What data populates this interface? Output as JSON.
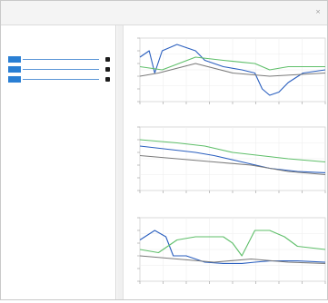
{
  "window": {
    "title": "",
    "close_glyph": "×"
  },
  "sidebar": {
    "section_label": "",
    "tracks": [
      {
        "label": "",
        "color": "#2a7fd4"
      },
      {
        "label": "",
        "color": "#2a7fd4"
      },
      {
        "label": "",
        "color": "#2a7fd4"
      }
    ]
  },
  "colors": {
    "blue": "#2a5fbf",
    "green": "#5fbf6a",
    "gray": "#7a7a7a",
    "accent": "#2a7fd4"
  },
  "charts": [
    {
      "name": "chart-1",
      "series": [
        {
          "color": "#2a5fbf",
          "points": [
            [
              0,
              0.3
            ],
            [
              0.05,
              0.2
            ],
            [
              0.08,
              0.55
            ],
            [
              0.12,
              0.2
            ],
            [
              0.2,
              0.1
            ],
            [
              0.3,
              0.2
            ],
            [
              0.35,
              0.35
            ],
            [
              0.45,
              0.45
            ],
            [
              0.55,
              0.5
            ],
            [
              0.62,
              0.55
            ],
            [
              0.66,
              0.8
            ],
            [
              0.7,
              0.9
            ],
            [
              0.75,
              0.85
            ],
            [
              0.8,
              0.7
            ],
            [
              0.88,
              0.55
            ],
            [
              1,
              0.5
            ]
          ]
        },
        {
          "color": "#5fbf6a",
          "points": [
            [
              0,
              0.45
            ],
            [
              0.12,
              0.5
            ],
            [
              0.3,
              0.3
            ],
            [
              0.45,
              0.35
            ],
            [
              0.55,
              0.38
            ],
            [
              0.62,
              0.4
            ],
            [
              0.7,
              0.5
            ],
            [
              0.8,
              0.45
            ],
            [
              1,
              0.45
            ]
          ]
        },
        {
          "color": "#7a7a7a",
          "points": [
            [
              0,
              0.6
            ],
            [
              0.1,
              0.55
            ],
            [
              0.3,
              0.4
            ],
            [
              0.5,
              0.55
            ],
            [
              0.7,
              0.6
            ],
            [
              1,
              0.55
            ]
          ]
        }
      ]
    },
    {
      "name": "chart-2",
      "series": [
        {
          "color": "#2a5fbf",
          "points": [
            [
              0,
              0.3
            ],
            [
              0.15,
              0.35
            ],
            [
              0.3,
              0.4
            ],
            [
              0.4,
              0.45
            ],
            [
              0.55,
              0.55
            ],
            [
              0.7,
              0.65
            ],
            [
              0.85,
              0.7
            ],
            [
              1,
              0.72
            ]
          ]
        },
        {
          "color": "#5fbf6a",
          "points": [
            [
              0,
              0.2
            ],
            [
              0.2,
              0.25
            ],
            [
              0.35,
              0.3
            ],
            [
              0.5,
              0.4
            ],
            [
              0.65,
              0.45
            ],
            [
              0.8,
              0.5
            ],
            [
              1,
              0.55
            ]
          ]
        },
        {
          "color": "#7a7a7a",
          "points": [
            [
              0,
              0.45
            ],
            [
              0.2,
              0.5
            ],
            [
              0.4,
              0.55
            ],
            [
              0.6,
              0.6
            ],
            [
              0.8,
              0.7
            ],
            [
              1,
              0.75
            ]
          ]
        }
      ]
    },
    {
      "name": "chart-3",
      "series": [
        {
          "color": "#2a5fbf",
          "points": [
            [
              0,
              0.35
            ],
            [
              0.08,
              0.2
            ],
            [
              0.14,
              0.3
            ],
            [
              0.18,
              0.6
            ],
            [
              0.25,
              0.6
            ],
            [
              0.35,
              0.7
            ],
            [
              0.45,
              0.72
            ],
            [
              0.55,
              0.72
            ],
            [
              0.62,
              0.7
            ],
            [
              0.7,
              0.68
            ],
            [
              0.85,
              0.68
            ],
            [
              1,
              0.7
            ]
          ]
        },
        {
          "color": "#5fbf6a",
          "points": [
            [
              0,
              0.5
            ],
            [
              0.1,
              0.55
            ],
            [
              0.2,
              0.35
            ],
            [
              0.3,
              0.3
            ],
            [
              0.45,
              0.3
            ],
            [
              0.5,
              0.4
            ],
            [
              0.55,
              0.6
            ],
            [
              0.62,
              0.2
            ],
            [
              0.7,
              0.2
            ],
            [
              0.78,
              0.3
            ],
            [
              0.85,
              0.45
            ],
            [
              1,
              0.5
            ]
          ]
        },
        {
          "color": "#7a7a7a",
          "points": [
            [
              0,
              0.6
            ],
            [
              0.2,
              0.65
            ],
            [
              0.4,
              0.7
            ],
            [
              0.6,
              0.65
            ],
            [
              0.8,
              0.7
            ],
            [
              1,
              0.72
            ]
          ]
        }
      ]
    }
  ]
}
